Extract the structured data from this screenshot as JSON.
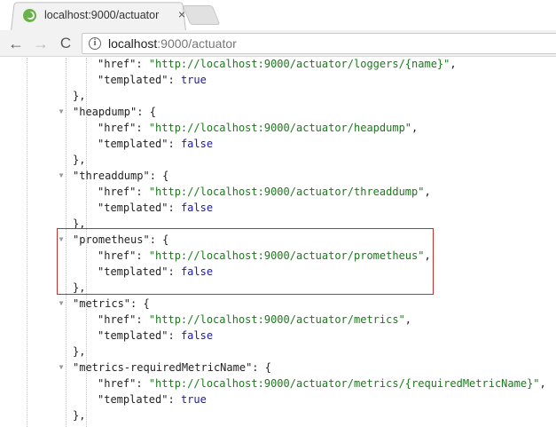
{
  "browser": {
    "tab_title": "localhost:9000/actuator",
    "close_glyph": "×",
    "url_host": "localhost",
    "url_path": ":9000/actuator",
    "back_glyph": "←",
    "forward_glyph": "→",
    "reload_glyph": "C",
    "info_glyph": "i"
  },
  "json_view": {
    "lines": [
      {
        "kind": "prop",
        "indent": 2,
        "key": "\"href\"",
        "value": "\"http://localhost:9000/actuator/loggers/{name}\"",
        "vtype": "string",
        "trail": ","
      },
      {
        "kind": "prop",
        "indent": 2,
        "key": "\"templated\"",
        "value": "true",
        "vtype": "bool",
        "trail": ""
      },
      {
        "kind": "close",
        "indent": 1,
        "text": "},"
      },
      {
        "kind": "open",
        "indent": 1,
        "key": "\"heapdump\"",
        "text": "{"
      },
      {
        "kind": "prop",
        "indent": 2,
        "key": "\"href\"",
        "value": "\"http://localhost:9000/actuator/heapdump\"",
        "vtype": "string",
        "trail": ","
      },
      {
        "kind": "prop",
        "indent": 2,
        "key": "\"templated\"",
        "value": "false",
        "vtype": "bool",
        "trail": ""
      },
      {
        "kind": "close",
        "indent": 1,
        "text": "},"
      },
      {
        "kind": "open",
        "indent": 1,
        "key": "\"threaddump\"",
        "text": "{"
      },
      {
        "kind": "prop",
        "indent": 2,
        "key": "\"href\"",
        "value": "\"http://localhost:9000/actuator/threaddump\"",
        "vtype": "string",
        "trail": ","
      },
      {
        "kind": "prop",
        "indent": 2,
        "key": "\"templated\"",
        "value": "false",
        "vtype": "bool",
        "trail": ""
      },
      {
        "kind": "close",
        "indent": 1,
        "text": "},"
      },
      {
        "kind": "open",
        "indent": 1,
        "key": "\"prometheus\"",
        "text": "{"
      },
      {
        "kind": "prop",
        "indent": 2,
        "key": "\"href\"",
        "value": "\"http://localhost:9000/actuator/prometheus\"",
        "vtype": "string",
        "trail": ","
      },
      {
        "kind": "prop",
        "indent": 2,
        "key": "\"templated\"",
        "value": "false",
        "vtype": "bool",
        "trail": ""
      },
      {
        "kind": "close",
        "indent": 1,
        "text": "},"
      },
      {
        "kind": "open",
        "indent": 1,
        "key": "\"metrics\"",
        "text": "{"
      },
      {
        "kind": "prop",
        "indent": 2,
        "key": "\"href\"",
        "value": "\"http://localhost:9000/actuator/metrics\"",
        "vtype": "string",
        "trail": ","
      },
      {
        "kind": "prop",
        "indent": 2,
        "key": "\"templated\"",
        "value": "false",
        "vtype": "bool",
        "trail": ""
      },
      {
        "kind": "close",
        "indent": 1,
        "text": "},"
      },
      {
        "kind": "open",
        "indent": 1,
        "key": "\"metrics-requiredMetricName\"",
        "text": "{"
      },
      {
        "kind": "prop",
        "indent": 2,
        "key": "\"href\"",
        "value": "\"http://localhost:9000/actuator/metrics/{requiredMetricName}\"",
        "vtype": "string",
        "trail": ","
      },
      {
        "kind": "prop",
        "indent": 2,
        "key": "\"templated\"",
        "value": "true",
        "vtype": "bool",
        "trail": ""
      },
      {
        "kind": "close",
        "indent": 1,
        "text": "},"
      }
    ]
  },
  "colors": {
    "string": "#1a7a1a",
    "boolean": "#1a1aa6",
    "highlight_border": "#c9302c"
  }
}
